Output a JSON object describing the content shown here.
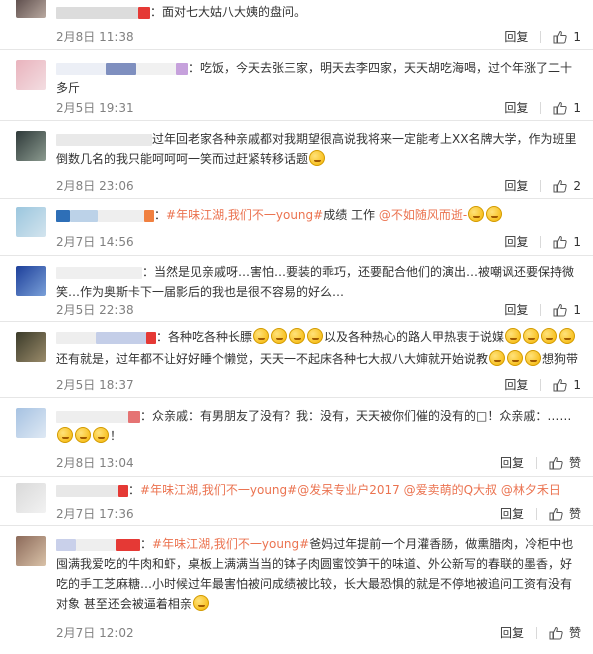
{
  "ui": {
    "reply_label": "回复"
  },
  "comments": [
    {
      "text": "：面对七大姑八大姨的盘问。",
      "date": "2月8日 11:38",
      "likes": "1"
    },
    {
      "text": "：吃饭，今天去张三家，明天去李四家，天天胡吃海喝，过个年涨了二十多斤",
      "date": "2月5日 19:31",
      "likes": "1"
    },
    {
      "text": "过年回老家各种亲戚都对我期望很高说我将来一定能考上XX名牌大学，作为班里倒数几名的我只能呵呵呵一笑而过赶紧转移话题",
      "date": "2月8日 23:06",
      "likes": "2"
    },
    {
      "topic": "#年味江湖,我们不一young#",
      "text": "成绩 工作",
      "mention": "@不如随风而逝-",
      "date": "2月7日 14:56",
      "likes": "1"
    },
    {
      "text": "：当然是见亲戚呀…害怕…要装的乖巧，还要配合他们的演出…被嘲讽还要保持微笑…作为奥斯卡下一届影后的我也是很不容易的好么…",
      "date": "2月5日 22:38",
      "likes": "1"
    },
    {
      "text1": "：各种吃各种长膘",
      "text2": "以及各种热心的路人甲热衷于说媒",
      "text3": "还有就是，过年都不让好好睡个懒觉，天天一不起床各种七大叔八大婶就开始说教",
      "text4": "想狗带",
      "date": "2月5日 18:37",
      "likes": "1"
    },
    {
      "text": "：众亲戚：有男朋友了没有？我：没有，天天被你们催的没有的□！众亲戚：……",
      "text_end": "！",
      "date": "2月8日 13:04",
      "likes": "赞"
    },
    {
      "topic": "#年味江湖,我们不一young#",
      "mention1": "@发呆专业户2017",
      "mention2": "@爱卖萌的Q大叔",
      "mention3": "@林夕禾日",
      "date": "2月7日 17:36",
      "likes": "赞"
    },
    {
      "topic": "#年味江湖,我们不一young#",
      "text": "爸妈过年提前一个月灌香肠，做熏腊肉，冷柜中也囤满我爱吃的牛肉和虾，桌板上满满当当的钵子肉圆蜜饺笋干的味道、外公新写的春联的墨香，好吃的手工芝麻糖…小时候过年最害怕被问成绩被比较，长大最恐惧的就是不停地被追问工资有没有对象 甚至还会被逼着相亲",
      "date": "2月7日 12:02",
      "likes": "赞"
    }
  ]
}
